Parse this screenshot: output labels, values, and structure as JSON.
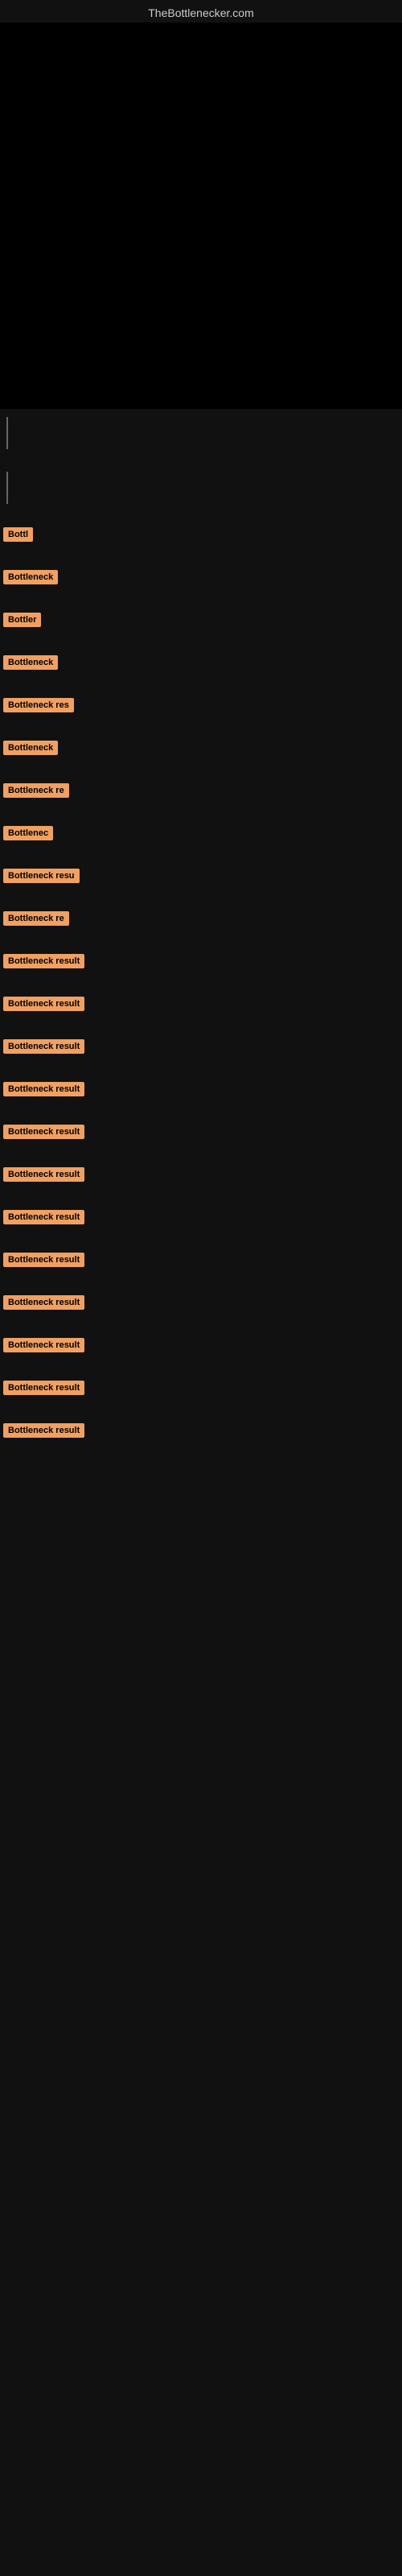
{
  "site": {
    "title": "TheBottlenecker.com"
  },
  "results": [
    {
      "id": 1,
      "label": "Bottl",
      "visible_text": "Bottl"
    },
    {
      "id": 2,
      "label": "Bottleneck",
      "visible_text": "Bottleneck"
    },
    {
      "id": 3,
      "label": "Bottler",
      "visible_text": "Bottler"
    },
    {
      "id": 4,
      "label": "Bottleneck",
      "visible_text": "Bottleneck"
    },
    {
      "id": 5,
      "label": "Bottleneck res",
      "visible_text": "Bottleneck res"
    },
    {
      "id": 6,
      "label": "Bottleneck",
      "visible_text": "Bottleneck"
    },
    {
      "id": 7,
      "label": "Bottleneck re",
      "visible_text": "Bottleneck re"
    },
    {
      "id": 8,
      "label": "Bottlenec",
      "visible_text": "Bottlenec"
    },
    {
      "id": 9,
      "label": "Bottleneck resu",
      "visible_text": "Bottleneck resu"
    },
    {
      "id": 10,
      "label": "Bottleneck re",
      "visible_text": "Bottleneck re"
    },
    {
      "id": 11,
      "label": "Bottleneck result",
      "visible_text": "Bottleneck result"
    },
    {
      "id": 12,
      "label": "Bottleneck result",
      "visible_text": "Bottleneck result"
    },
    {
      "id": 13,
      "label": "Bottleneck result",
      "visible_text": "Bottleneck result"
    },
    {
      "id": 14,
      "label": "Bottleneck result",
      "visible_text": "Bottleneck result"
    },
    {
      "id": 15,
      "label": "Bottleneck result",
      "visible_text": "Bottleneck result"
    },
    {
      "id": 16,
      "label": "Bottleneck result",
      "visible_text": "Bottleneck result"
    },
    {
      "id": 17,
      "label": "Bottleneck result",
      "visible_text": "Bottleneck result"
    },
    {
      "id": 18,
      "label": "Bottleneck result",
      "visible_text": "Bottleneck result"
    },
    {
      "id": 19,
      "label": "Bottleneck result",
      "visible_text": "Bottleneck result"
    },
    {
      "id": 20,
      "label": "Bottleneck result",
      "visible_text": "Bottleneck result"
    },
    {
      "id": 21,
      "label": "Bottleneck result",
      "visible_text": "Bottleneck result"
    },
    {
      "id": 22,
      "label": "Bottleneck result",
      "visible_text": "Bottleneck result"
    }
  ],
  "accent_color": "#f0a060"
}
